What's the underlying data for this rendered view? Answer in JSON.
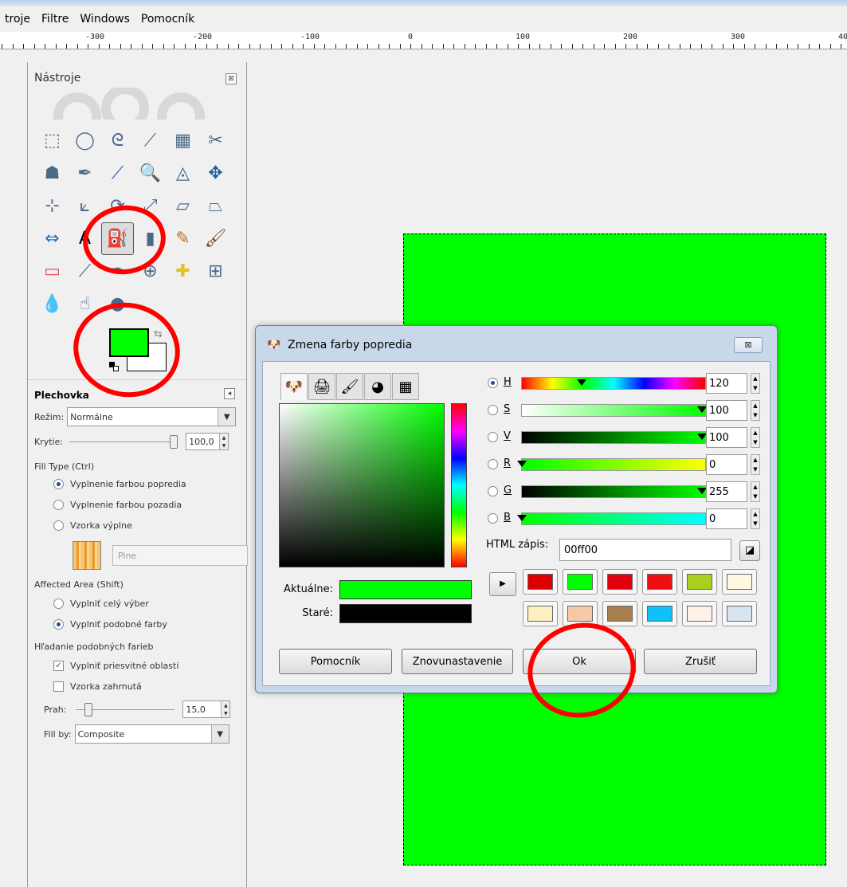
{
  "menu": [
    "troje",
    "Filtre",
    "Windows",
    "Pomocník"
  ],
  "ruler_labels": [
    "-300",
    "-200",
    "-100",
    "0",
    "100",
    "200",
    "300",
    "400"
  ],
  "toolbox": {
    "title": "Nástroje",
    "close_glyph": "⊠",
    "fg_color": "#00ff00",
    "bg_color": "#ffffff",
    "tool_icons": [
      "rect-select-icon",
      "ellipse-select-icon",
      "lasso-icon",
      "fuzzy-select-icon",
      "color-select-icon",
      "scissors-icon",
      "foreground-select-icon",
      "paths-icon",
      "color-picker-icon",
      "zoom-icon",
      "measure-icon",
      "move-icon",
      "align-icon",
      "crop-icon",
      "rotate-icon",
      "scale-icon",
      "shear-icon",
      "perspective-icon",
      "flip-icon",
      "text-icon",
      "bucket-fill-icon",
      "blend-icon",
      "pencil-icon",
      "paintbrush-icon",
      "eraser-icon",
      "airbrush-icon",
      "ink-icon",
      "clone-icon",
      "heal-icon",
      "perspective-clone-icon",
      "blur-icon",
      "smudge-icon",
      "dodge-icon"
    ]
  },
  "options": {
    "title": "Plechovka",
    "mode_label": "Režim:",
    "mode_value": "Normálne",
    "opacity_label": "Krytie:",
    "opacity_value": "100,0",
    "opacity_fraction": 1.0,
    "fill_type_label": "Fill Type  (Ctrl)",
    "fill_fg": "Vyplnenie farbou popredia",
    "fill_bg": "Vyplnenie farbou pozadia",
    "fill_pattern": "Vzorka výplne",
    "pattern_name": "Pine",
    "affected_label": "Affected Area  (Shift)",
    "affected_selection": "Vyplniť celý výber",
    "affected_similar": "Vyplniť podobné farby",
    "similar_label": "Hľadanie podobných farieb",
    "fill_transparent": "Vyplniť priesvitné oblasti",
    "sample_merged": "Vzorka zahrnutá",
    "threshold_label": "Prah:",
    "threshold_value": "15,0",
    "threshold_fraction": 0.06,
    "fill_by_label": "Fill by:",
    "fill_by_value": "Composite"
  },
  "dialog": {
    "title": "Zmena farby popredia",
    "close_glyph": "⊠",
    "current_label": "Aktuálne:",
    "old_label": "Staré:",
    "current_color": "#00ff00",
    "old_color": "#000000",
    "channels": [
      {
        "key": "H",
        "value": "120",
        "fraction": 0.333,
        "checked": true
      },
      {
        "key": "S",
        "value": "100",
        "fraction": 1.0,
        "checked": false
      },
      {
        "key": "V",
        "value": "100",
        "fraction": 1.0,
        "checked": false
      },
      {
        "key": "R",
        "value": "0",
        "fraction": 0.0,
        "checked": false
      },
      {
        "key": "G",
        "value": "255",
        "fraction": 1.0,
        "checked": false
      },
      {
        "key": "B",
        "value": "0",
        "fraction": 0.0,
        "checked": false
      }
    ],
    "html_label": "HTML zápis:",
    "html_value": "00ff00",
    "history_colors": [
      "#dd0000",
      "#00ff00",
      "#e00010",
      "#ee1010",
      "#a8d020",
      "#fff8e0",
      "#fff0c0",
      "#f5c8a8",
      "#a88050",
      "#10c0f8",
      "#fff0e8",
      "#d8e4f0"
    ],
    "buttons": {
      "help": "Pomocník",
      "reset": "Znovunastavenie",
      "ok": "Ok",
      "cancel": "Zrušiť"
    }
  }
}
